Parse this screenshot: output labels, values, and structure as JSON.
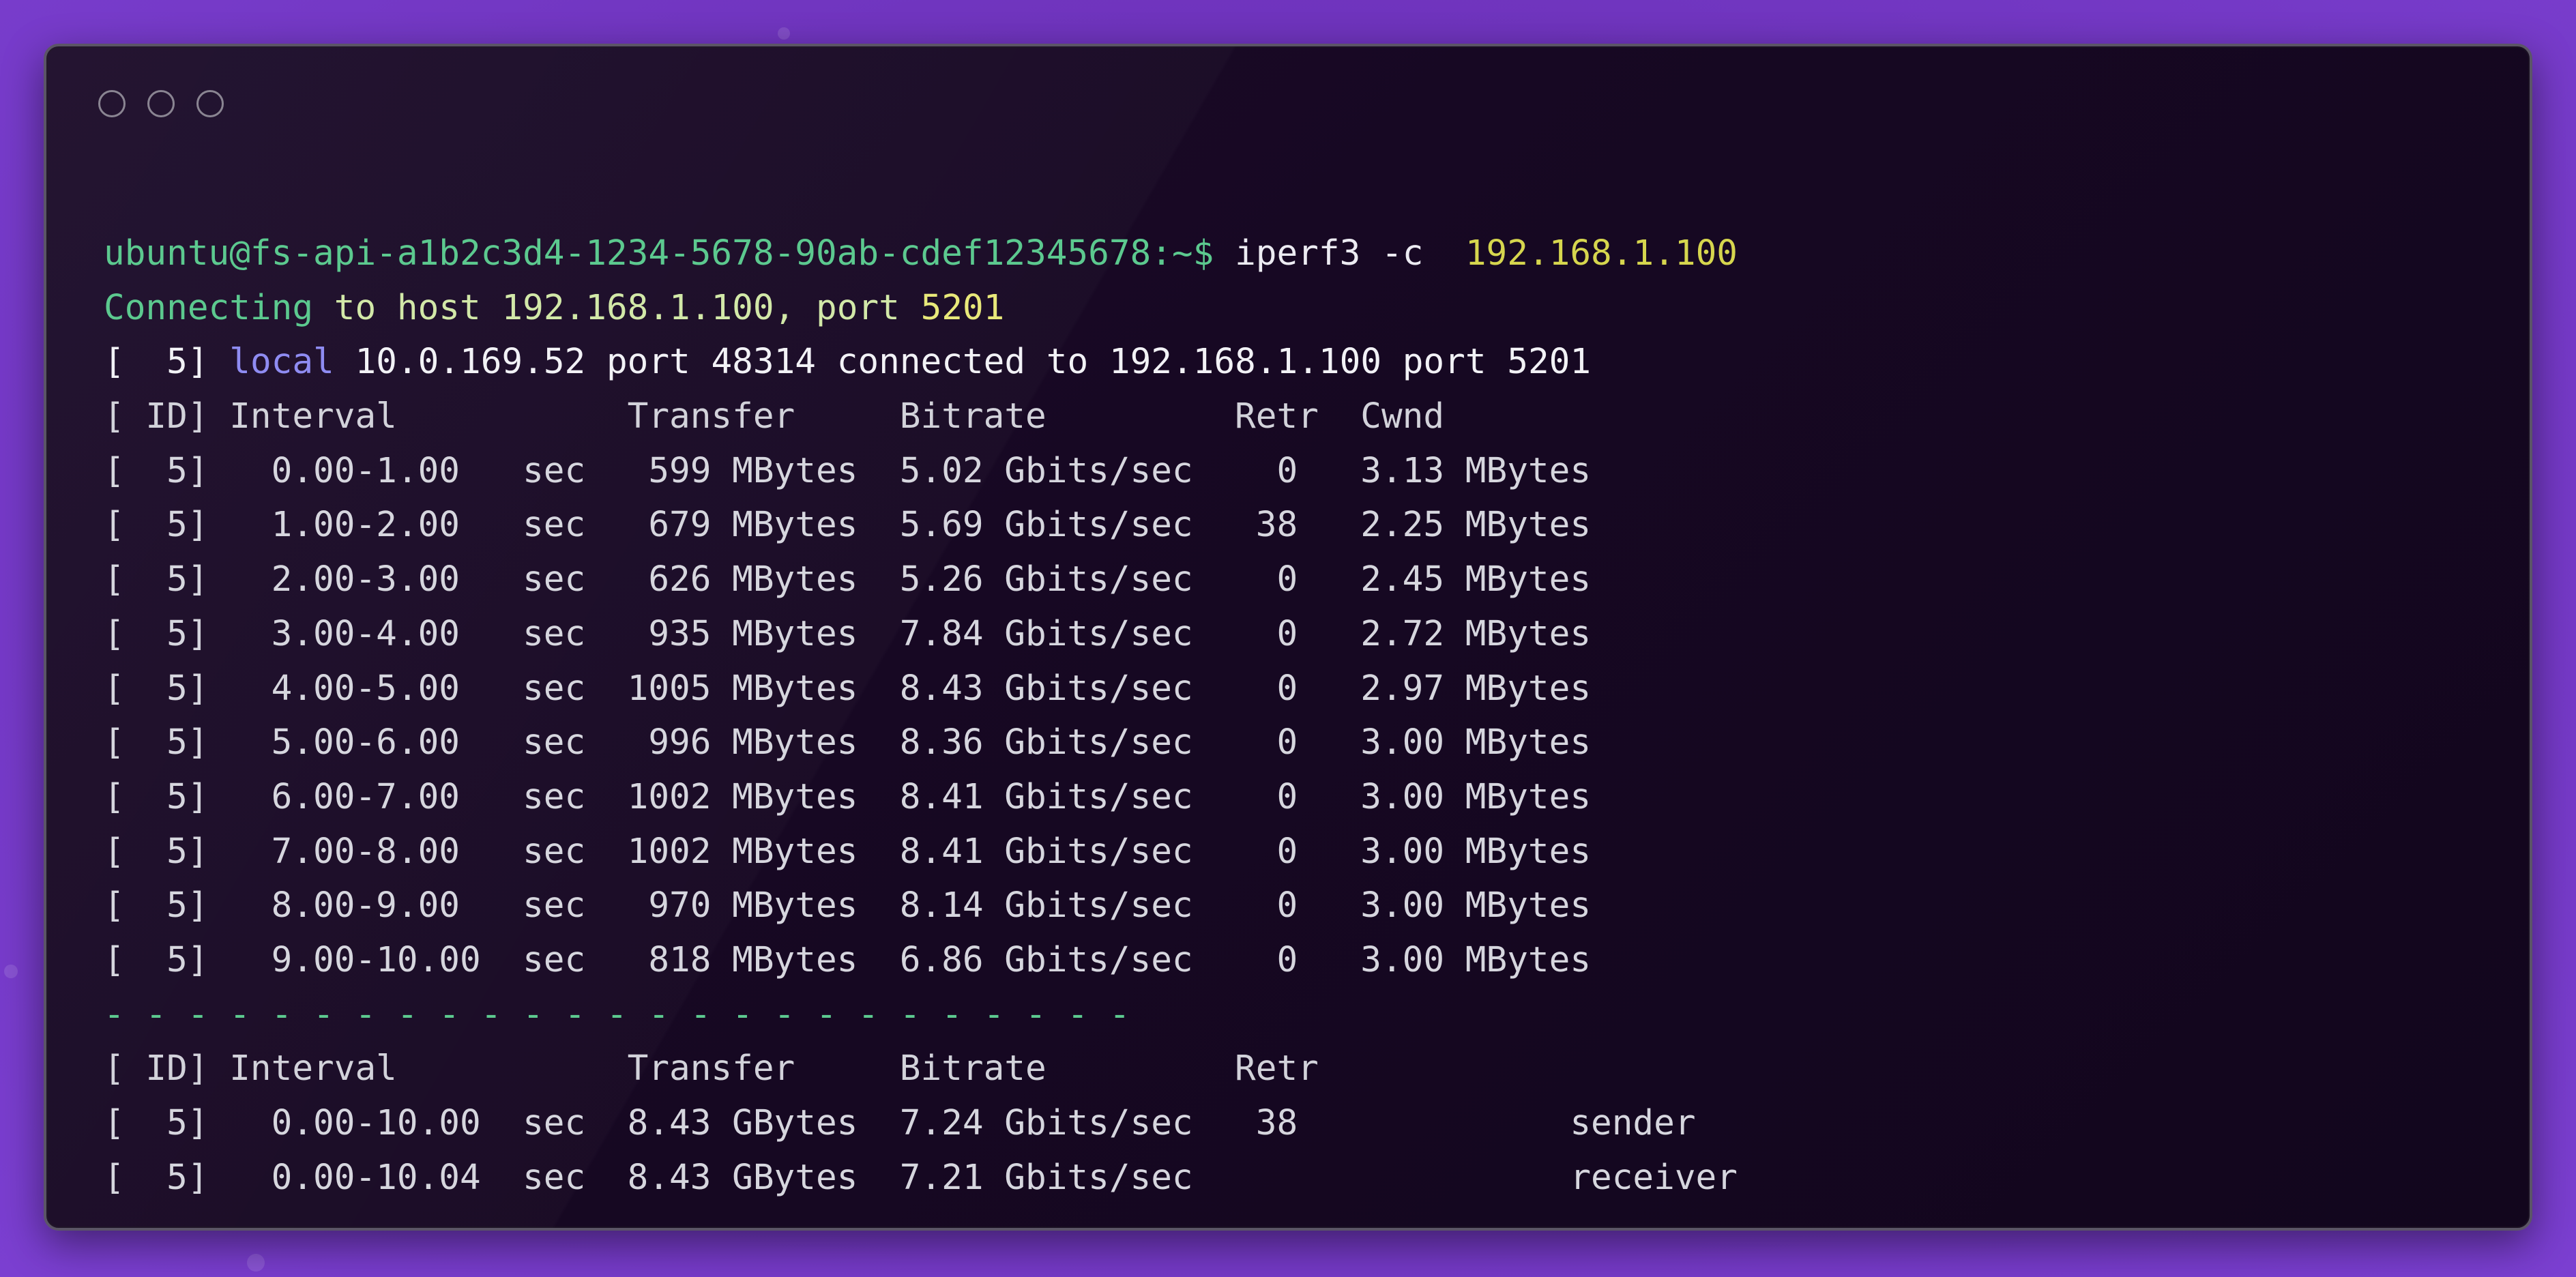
{
  "terminal": {
    "prompt": "ubuntu@fs-api-a1b2c3d4-1234-5678-90ab-cdef12345678:~$",
    "command": "iperf3 -c",
    "command_arg": "192.168.1.100",
    "connecting": {
      "word": "Connecting",
      "to_host": "to host",
      "host": "192.168.1.100,",
      "port_word": "port",
      "port": "5201"
    },
    "local_line": {
      "prefix": "[  5]",
      "keyword": "local",
      "rest": "10.0.169.52 port 48314 connected to 192.168.1.100 port 5201"
    },
    "header": "[ ID] Interval           Transfer     Bitrate         Retr  Cwnd",
    "intervals": [
      "[  5]   0.00-1.00   sec   599 MBytes  5.02 Gbits/sec    0   3.13 MBytes",
      "[  5]   1.00-2.00   sec   679 MBytes  5.69 Gbits/sec   38   2.25 MBytes",
      "[  5]   2.00-3.00   sec   626 MBytes  5.26 Gbits/sec    0   2.45 MBytes",
      "[  5]   3.00-4.00   sec   935 MBytes  7.84 Gbits/sec    0   2.72 MBytes",
      "[  5]   4.00-5.00   sec  1005 MBytes  8.43 Gbits/sec    0   2.97 MBytes",
      "[  5]   5.00-6.00   sec   996 MBytes  8.36 Gbits/sec    0   3.00 MBytes",
      "[  5]   6.00-7.00   sec  1002 MBytes  8.41 Gbits/sec    0   3.00 MBytes",
      "[  5]   7.00-8.00   sec  1002 MBytes  8.41 Gbits/sec    0   3.00 MBytes",
      "[  5]   8.00-9.00   sec   970 MBytes  8.14 Gbits/sec    0   3.00 MBytes",
      "[  5]   9.00-10.00  sec   818 MBytes  6.86 Gbits/sec    0   3.00 MBytes"
    ],
    "separator": "- - - - - - - - - - - - - - - - - - - - - - - - -",
    "summary_header": "[ ID] Interval           Transfer     Bitrate         Retr",
    "summary": [
      "[  5]   0.00-10.00  sec  8.43 GBytes  7.24 Gbits/sec   38             sender",
      "[  5]   0.00-10.04  sec  8.43 GBytes  7.21 Gbits/sec                  receiver"
    ]
  },
  "colors": {
    "background": "#6f34bd",
    "window": "#170823",
    "prompt": "#5cc98f",
    "argument": "#d6d64e",
    "local_keyword": "#8f8cf2",
    "text": "#d6d6de"
  }
}
